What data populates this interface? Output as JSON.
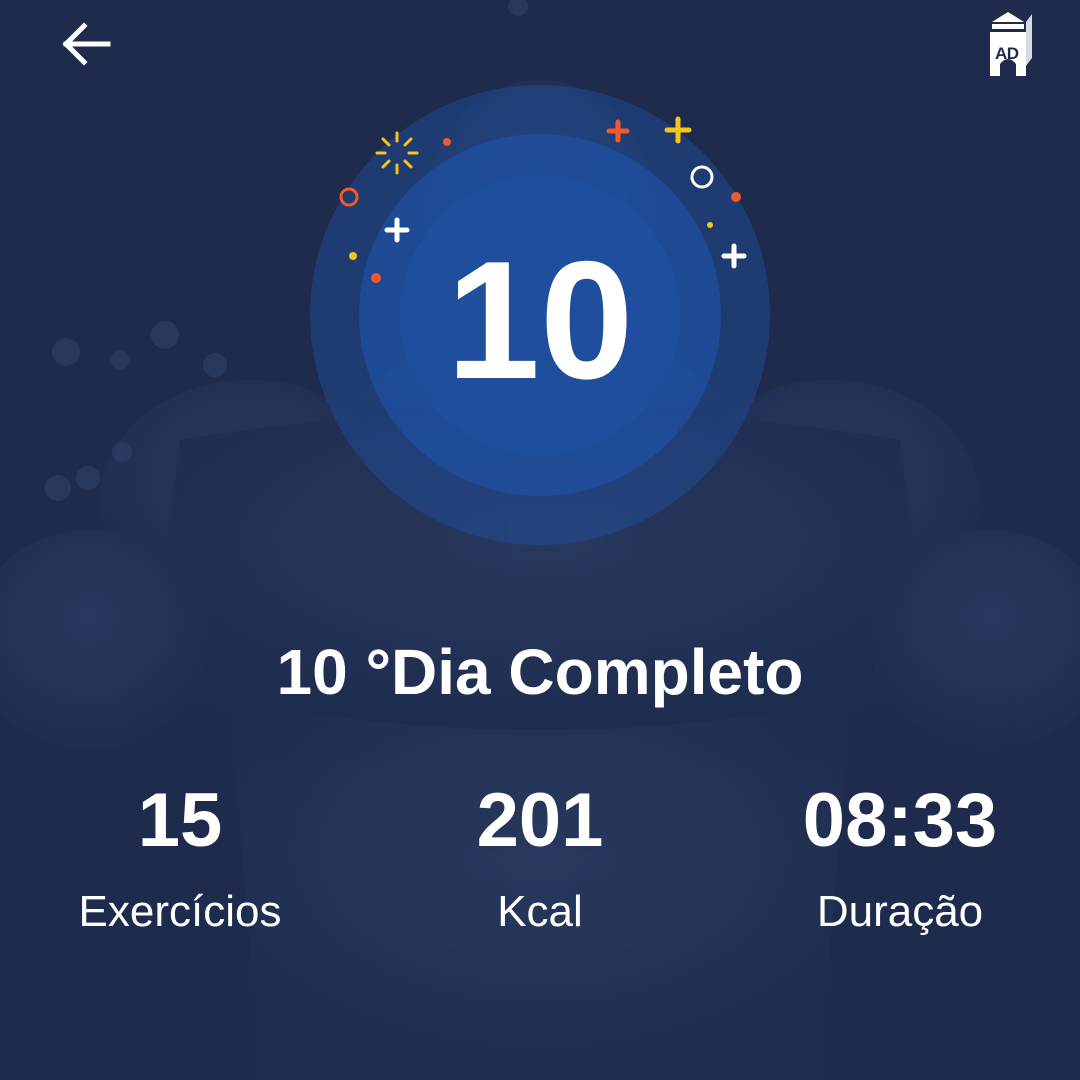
{
  "app": {
    "back_icon": "arrow-left-icon",
    "ad_icon": "ad-castle-icon",
    "ad_label": "AD"
  },
  "badge": {
    "number": "10",
    "confetti_colors": [
      "#f5c518",
      "#f05a28",
      "#ffffff"
    ]
  },
  "completion": {
    "title": "10 °Dia Completo"
  },
  "stats": [
    {
      "value": "15",
      "label": "Exercícios"
    },
    {
      "value": "201",
      "label": "Kcal"
    },
    {
      "value": "08:33",
      "label": "Duração"
    }
  ],
  "colors": {
    "background": "#1e2b4c",
    "badge_inner": "#1f4f9c",
    "text": "#ffffff"
  }
}
